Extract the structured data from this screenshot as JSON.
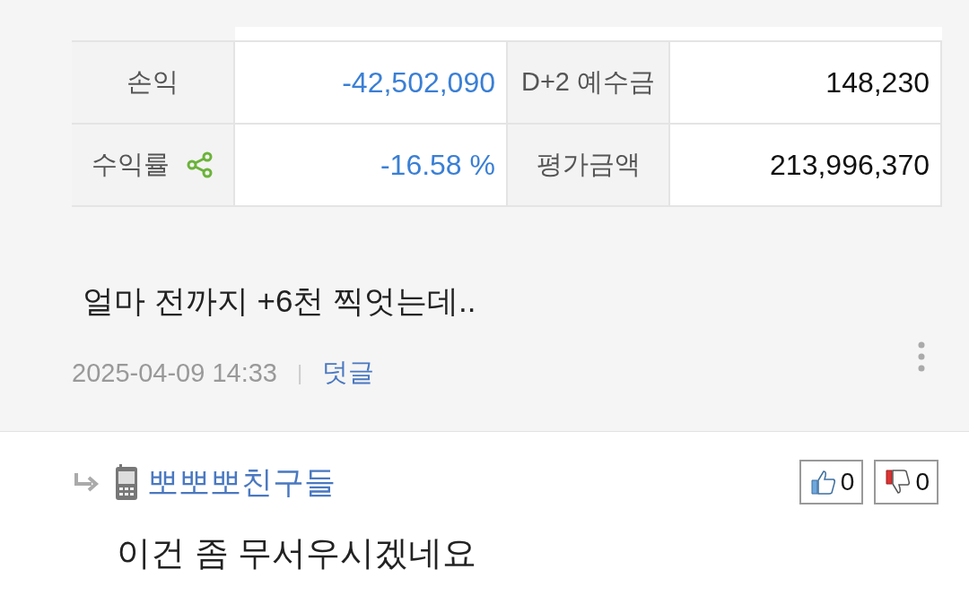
{
  "summary_table": {
    "rows": [
      {
        "cells": [
          {
            "kind": "label",
            "text": "손익"
          },
          {
            "kind": "value",
            "text": "-42,502,090",
            "color": "#3a7fd5"
          },
          {
            "kind": "label",
            "text": "D+2 예수금"
          },
          {
            "kind": "value",
            "text": "148,230",
            "color": "#111111"
          }
        ]
      },
      {
        "cells": [
          {
            "kind": "label",
            "text": "수익률",
            "share": true
          },
          {
            "kind": "value",
            "text": "-16.58 %",
            "color": "#3a7fd5"
          },
          {
            "kind": "label",
            "text": "평가금액"
          },
          {
            "kind": "value",
            "text": "213,996,370",
            "color": "#111111"
          }
        ]
      }
    ]
  },
  "post": {
    "body": "얼마 전까지 +6천 찍엇는데..",
    "date": "2025-04-09 14:33",
    "separator": "|",
    "comment_link": "덧글"
  },
  "comment": {
    "author": "뽀뽀뽀친구들",
    "likes": "0",
    "dislikes": "0",
    "body": "이건 좀 무서우시겠네요"
  }
}
